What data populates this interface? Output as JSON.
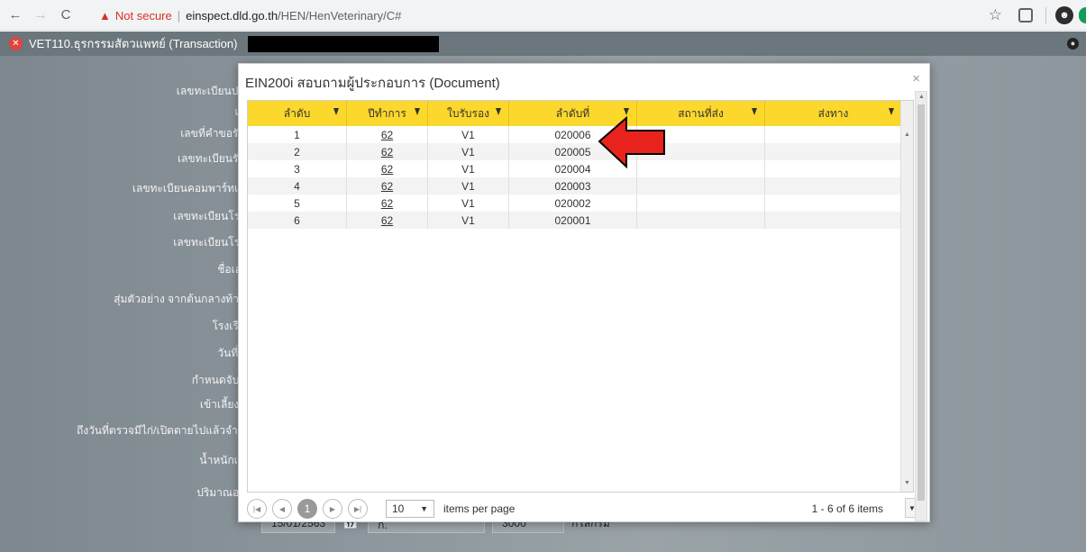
{
  "browser": {
    "back_icon": "←",
    "forward_icon": "→",
    "reload_icon": "C",
    "security_warning": "Not secure",
    "url_host": "einspect.dld.go.th",
    "url_path": "/HEN/HenVeterinary/C#"
  },
  "page": {
    "header_title": "VET110.ธุรกรรมสัตวแพทย์ (Transaction)",
    "labels": [
      "เลขทะเบียนปศุ",
      "เล",
      "เลขที่คำขอรับ",
      "เลขทะเบียนรับ",
      "เลขทะเบียนคอมพาร์ทเม",
      "เลขทะเบียนโรง",
      "เลขทะเบียนโรง",
      "ชื่อเอเ",
      "สุ่มตัวอย่าง จากต้นกลางท้าย",
      "โรงเรือ",
      "วันที่ต",
      "กำหนดจับวั",
      "เข้าเลี้ยงวั",
      "ถึงวันที่ตรวจมีไก่/เปิดตายไปแล้วจำน",
      "น้ำหนักเฉ",
      "ปริมาณอา"
    ],
    "bottom_row": {
      "date": "15/01/2563",
      "unit_short": "ก.",
      "amount": "3000",
      "unit_long": "กิโลกรัม"
    }
  },
  "modal": {
    "title": "EIN200i สอบถามผู้ประกอบการ (Document)",
    "close": "×",
    "columns": [
      "ลำดับ",
      "ปีทำการ",
      "ใบรับรอง",
      "ลำดับที่",
      "สถานที่ส่ง",
      "ส่งทาง"
    ],
    "rows": [
      [
        "1",
        "62",
        "V1",
        "020006",
        "",
        ""
      ],
      [
        "2",
        "62",
        "V1",
        "020005",
        "",
        ""
      ],
      [
        "3",
        "62",
        "V1",
        "020004",
        "",
        ""
      ],
      [
        "4",
        "62",
        "V1",
        "020003",
        "",
        ""
      ],
      [
        "5",
        "62",
        "V1",
        "020002",
        "",
        ""
      ],
      [
        "6",
        "62",
        "V1",
        "020001",
        "",
        ""
      ]
    ],
    "pager": {
      "current_page": "1",
      "page_size": "10",
      "items_per_page_text": "items per page",
      "info": "1 - 6 of 6 items"
    }
  }
}
